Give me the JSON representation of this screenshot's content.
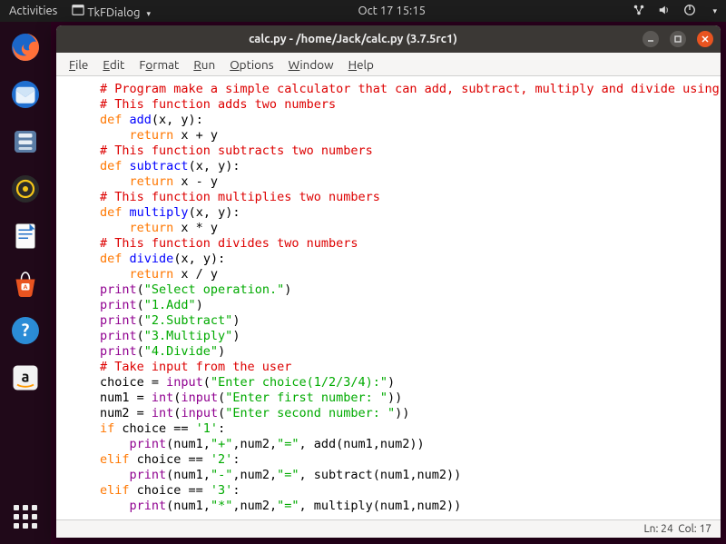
{
  "panel": {
    "activities": "Activities",
    "app_menu": "TkFDialog",
    "clock": "Oct 17  15:15"
  },
  "window": {
    "title": "calc.py - /home/Jack/calc.py (3.7.5rc1)"
  },
  "menubar": {
    "file": "File",
    "edit": "Edit",
    "format": "Format",
    "run": "Run",
    "options": "Options",
    "window": "Window",
    "help": "Help"
  },
  "status": {
    "line_label": "Ln:",
    "line": "24",
    "col_label": "Col:",
    "col": "17"
  },
  "code": {
    "l1": "# Program make a simple calculator that can add, subtract, multiply and divide using",
    "l2": "# This function adds two numbers",
    "l3a": "def",
    "l3b": "add",
    "l3c": "(x, y):",
    "l4a": "    ",
    "l4b": "return",
    "l4c": " x + y",
    "l5": "# This function subtracts two numbers",
    "l6a": "def",
    "l6b": "subtract",
    "l6c": "(x, y):",
    "l7a": "    ",
    "l7b": "return",
    "l7c": " x - y",
    "l8": "# This function multiplies two numbers",
    "l9a": "def",
    "l9b": "multiply",
    "l9c": "(x, y):",
    "l10a": "    ",
    "l10b": "return",
    "l10c": " x * y",
    "l11": "# This function divides two numbers",
    "l12a": "def",
    "l12b": "divide",
    "l12c": "(x, y):",
    "l13a": "    ",
    "l13b": "return",
    "l13c": " x / y",
    "l14a": "print",
    "l14b": "(",
    "l14c": "\"Select operation.\"",
    "l14d": ")",
    "l15a": "print",
    "l15b": "(",
    "l15c": "\"1.Add\"",
    "l15d": ")",
    "l16a": "print",
    "l16b": "(",
    "l16c": "\"2.Subtract\"",
    "l16d": ")",
    "l17a": "print",
    "l17b": "(",
    "l17c": "\"3.Multiply\"",
    "l17d": ")",
    "l18a": "print",
    "l18b": "(",
    "l18c": "\"4.Divide\"",
    "l18d": ")",
    "l19": "# Take input from the user",
    "l20a": "choice = ",
    "l20b": "input",
    "l20c": "(",
    "l20d": "\"Enter choice(1/2/3/4):\"",
    "l20e": ")",
    "l21a": "num1 = ",
    "l21b": "int",
    "l21c": "(",
    "l21d": "input",
    "l21e": "(",
    "l21f": "\"Enter first number: \"",
    "l21g": "))",
    "l22a": "num2 = ",
    "l22b": "int",
    "l22c": "(",
    "l22d": "input",
    "l22e": "(",
    "l22f": "\"Enter second number: \"",
    "l22g": "))",
    "l23a": "if",
    "l23b": " choice == ",
    "l23c": "'1'",
    "l23d": ":",
    "l24a": "    ",
    "l24b": "print",
    "l24c": "(num1,",
    "l24d": "\"+\"",
    "l24e": ",num2,",
    "l24f": "\"=\"",
    "l24g": ", add(num1,num2))",
    "l25a": "elif",
    "l25b": " choice == ",
    "l25c": "'2'",
    "l25d": ":",
    "l26a": "    ",
    "l26b": "print",
    "l26c": "(num1,",
    "l26d": "\"-\"",
    "l26e": ",num2,",
    "l26f": "\"=\"",
    "l26g": ", subtract(num1,num2))",
    "l27a": "elif",
    "l27b": " choice == ",
    "l27c": "'3'",
    "l27d": ":",
    "l28a": "    ",
    "l28b": "print",
    "l28c": "(num1,",
    "l28d": "\"*\"",
    "l28e": ",num2,",
    "l28f": "\"=\"",
    "l28g": ", multiply(num1,num2))"
  }
}
